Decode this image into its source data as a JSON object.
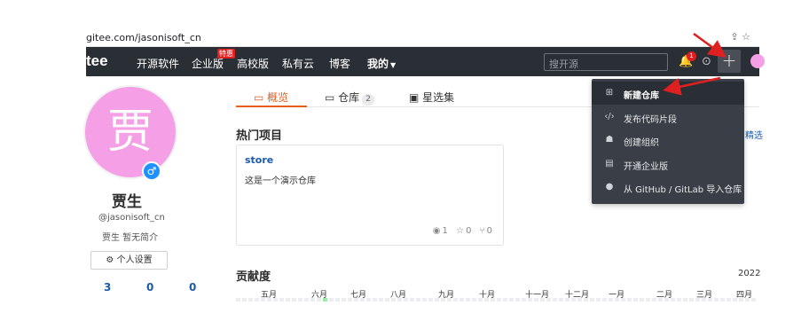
{
  "browser": {
    "url": "gitee.com/jasonisoft_cn"
  },
  "nav": {
    "brand": "tee",
    "links": [
      "开源软件",
      "企业版",
      "高校版",
      "私有云",
      "博客"
    ],
    "hot_badge": "特惠",
    "mine": "我的",
    "search_placeholder": "搜开源",
    "notification_count": "1",
    "add_symbol": "+"
  },
  "profile": {
    "avatar_char": "贾",
    "name": "贾生",
    "handle": "@jasonisoft_cn",
    "bio": "贾生 暂无简介",
    "settings_label": "个人设置",
    "stats": [
      "3",
      "0",
      "0"
    ]
  },
  "tabs": [
    {
      "label": "概览"
    },
    {
      "label": "仓库",
      "count": "2"
    },
    {
      "label": "星选集"
    }
  ],
  "hot_projects": {
    "title": "热门项目",
    "more": "精选",
    "repo": {
      "name": "store",
      "desc": "这是一个演示仓库",
      "watch": "1",
      "star": "0",
      "fork": "0"
    }
  },
  "contribution": {
    "title": "贡献度",
    "year": "2022",
    "months": [
      "五月",
      "六月",
      "七月",
      "八月",
      "九月",
      "十月",
      "十一月",
      "十二月",
      "一月",
      "二月",
      "三月",
      "四月"
    ]
  },
  "dropdown": {
    "items": [
      {
        "label": "新建仓库",
        "icon": "plus-square-icon"
      },
      {
        "label": "发布代码片段",
        "icon": "code-icon"
      },
      {
        "label": "创建组织",
        "icon": "group-icon"
      },
      {
        "label": "开通企业版",
        "icon": "building-icon"
      },
      {
        "label": "从 GitHub / GitLab 导入仓库",
        "icon": "github-icon"
      }
    ]
  },
  "colors": {
    "nav_bg": "#2a2e35",
    "accent": "#e85d1b",
    "link": "#1c5aa8",
    "avatar": "#f59fe6",
    "arrow": "#e02020"
  }
}
